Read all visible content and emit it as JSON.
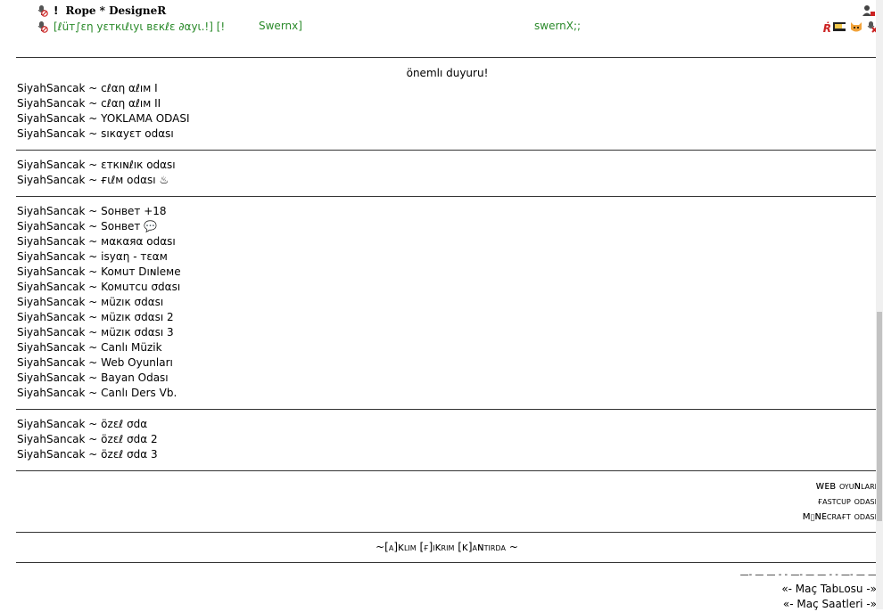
{
  "header": {
    "bang": "!",
    "title": "Rope * DesigneR",
    "topic_left": "[ℓüт∫εη уεткιℓιуι вεкℓε ∂αуι.!] [!",
    "topic_mid": "Swernx]",
    "topic_right": "swernX;;",
    "r_glyph": "Ṙ"
  },
  "rooms": {
    "announcement": "önemlı duyuru!",
    "group1": [
      "SiyahSancak ~ cℓαη αℓıм I",
      "SiyahSancak ~ cℓαη αℓıм II",
      "SiyahSancak ~ YOKLAMA ODASI",
      "SiyahSancak ~ sıкαуεт odαsı"
    ],
    "group2": [
      "SiyahSancak ~ εткıɴℓıк odαsı",
      "SiyahSancak ~ ғιℓм odαsı"
    ],
    "group2_film_icon": "♨",
    "group3": [
      "SiyahSancak ~ Soнвeт +18",
      "SiyahSancak ~ Soнвeт",
      "SiyahSancak ~ мαкαяα odαsı",
      "SiyahSancak ~ isуαη - тεαм",
      "SiyahSancak ~ Koмuт Dıɴleмe",
      "SiyahSancak ~ Koмuтcu σdαsı",
      "SiyahSancak ~ мüzıк σdαsı",
      "SiyahSancak ~ мüzıк σdαsı 2",
      "SiyahSancak ~ мüzıк σdαsı 3",
      "SiyahSancak ~ Canlı Müzik",
      "SiyahSancak ~ Web Oyunları",
      "SiyahSancak ~ Bayan Odası",
      "SiyahSancak ~ Canlı Ders Vb."
    ],
    "group3_chat_icon": "💬",
    "group4": [
      "SiyahSancak ~ özεℓ σdα",
      "SiyahSancak ~ özεℓ σdα 2",
      "SiyahSancak ~ özεℓ σdα 3"
    ],
    "group5": [
      "ᴡᴇʙ oyuɴlαrı",
      "ғαsтcup odαsı",
      "ᴍɪɴᴇcrαғт odαsı"
    ],
    "slogan": "~[α]ĸlιм [ғ]ιĸrιм [ĸ]αɴтιrdα ~",
    "dashes": "—- — — - - —- — — - - —- — —",
    "links": [
      "«-  Maç Tabʟosu  -»",
      "«- Maç Saatleri -»"
    ]
  },
  "colors": {
    "topic_green": "#2a8a2a",
    "muted_red": "#cc2222"
  }
}
